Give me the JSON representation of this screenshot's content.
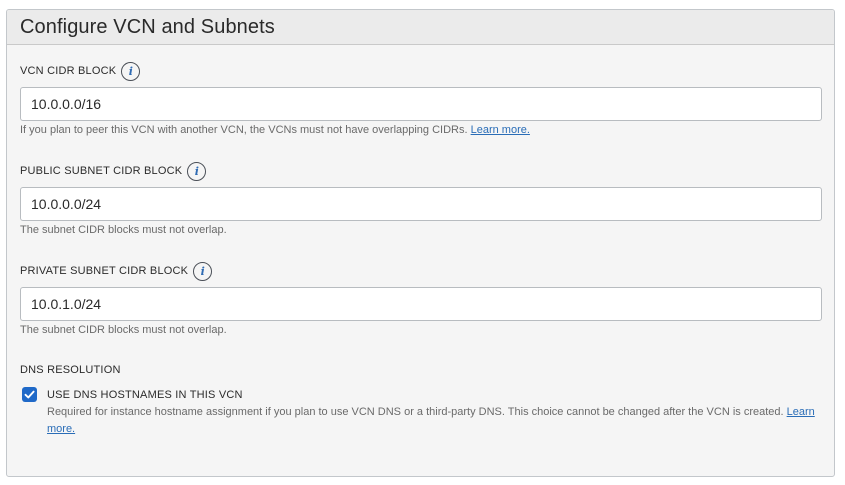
{
  "panel": {
    "title": "Configure VCN and Subnets"
  },
  "vcn_cidr": {
    "label": "VCN CIDR BLOCK",
    "value": "10.0.0.0/16",
    "help": "If you plan to peer this VCN with another VCN, the VCNs must not have overlapping CIDRs.",
    "help_link": "Learn more."
  },
  "public_subnet": {
    "label": "PUBLIC SUBNET CIDR BLOCK",
    "value": "10.0.0.0/24",
    "help": "The subnet CIDR blocks must not overlap."
  },
  "private_subnet": {
    "label": "PRIVATE SUBNET CIDR BLOCK",
    "value": "10.0.1.0/24",
    "help": "The subnet CIDR blocks must not overlap."
  },
  "dns": {
    "section_label": "DNS RESOLUTION",
    "checkbox_label": "USE DNS HOSTNAMES IN THIS VCN",
    "checked": true,
    "description": "Required for instance hostname assignment if you plan to use VCN DNS or a third-party DNS. This choice cannot be changed after the VCN is created.",
    "learn_more": "Learn more."
  },
  "icons": {
    "info": "info-icon",
    "check": "checkmark-icon"
  },
  "colors": {
    "accent": "#1f69c8",
    "link": "#2a6db7",
    "info_glyph": "#2f6bb3"
  }
}
